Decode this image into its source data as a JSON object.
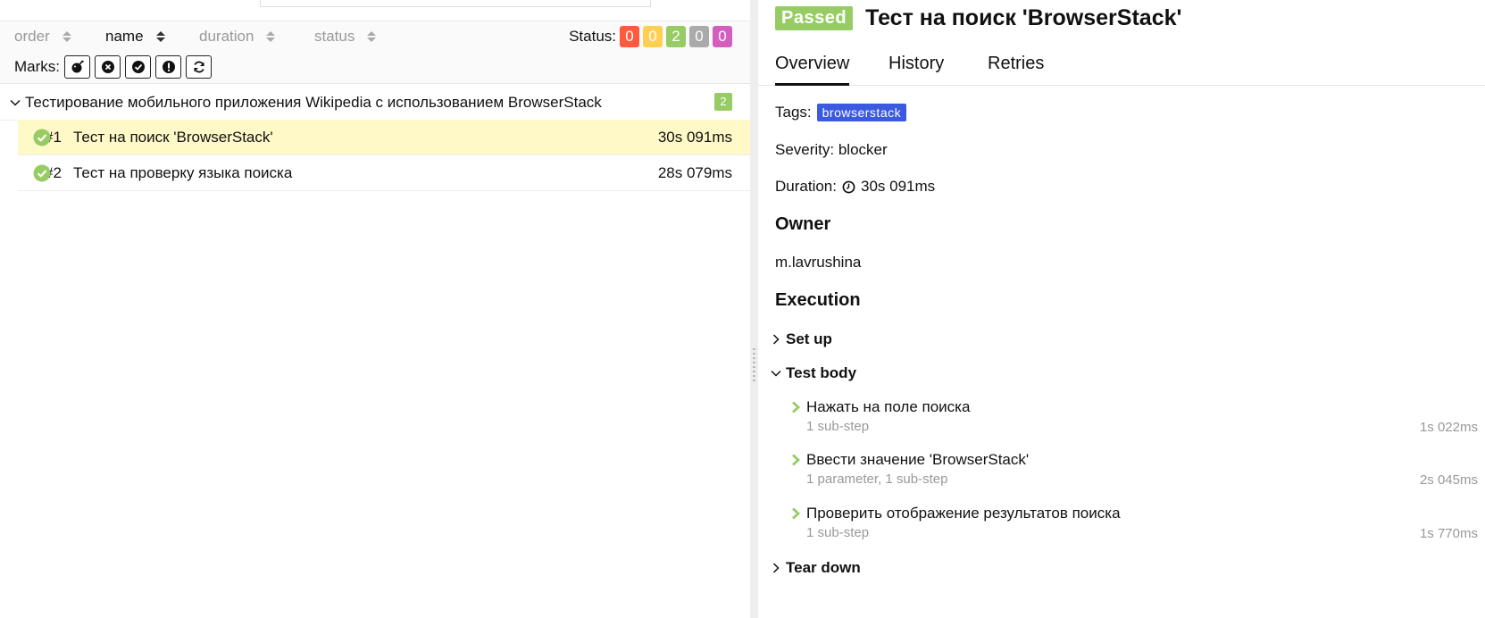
{
  "sortbar": {
    "sorts": [
      "order",
      "name",
      "duration",
      "status"
    ],
    "status_label": "Status:",
    "counts": [
      {
        "value": "0",
        "color": "#fd5a3e"
      },
      {
        "value": "0",
        "color": "#ffd050"
      },
      {
        "value": "2",
        "color": "#97cc64"
      },
      {
        "value": "0",
        "color": "#aaaaaa"
      },
      {
        "value": "0",
        "color": "#d35ebe"
      }
    ],
    "marks_label": "Marks:",
    "mark_icons": [
      "bomb-icon",
      "times-circle-icon",
      "check-circle-icon",
      "exclamation-circle-icon",
      "refresh-icon"
    ]
  },
  "suite": {
    "name": "Тестирование мобильного приложения Wikipedia с использованием BrowserStack",
    "count": "2"
  },
  "tests": [
    {
      "num": "#1",
      "name": "Тест на поиск 'BrowserStack'",
      "duration": "30s 091ms"
    },
    {
      "num": "#2",
      "name": "Тест на проверку языка поиска",
      "duration": "28s 079ms"
    }
  ],
  "detail": {
    "status": "Passed",
    "title": "Тест на поиск 'BrowserStack'",
    "tabs": [
      "Overview",
      "History",
      "Retries"
    ],
    "tags_label": "Tags:",
    "tag": "browserstack",
    "severity": "Severity: blocker",
    "duration_label": "Duration:",
    "duration": "30s 091ms",
    "owner_heading": "Owner",
    "owner": "m.lavrushina",
    "execution_heading": "Execution",
    "setup": "Set up",
    "test_body": "Test body",
    "teardown": "Tear down",
    "steps": [
      {
        "name": "Нажать на поле поиска",
        "sub": "1 sub-step",
        "duration": "1s 022ms"
      },
      {
        "name": "Ввести значение 'BrowserStack'",
        "sub": "1 parameter, 1 sub-step",
        "duration": "2s 045ms"
      },
      {
        "name": "Проверить отображение результатов поиска",
        "sub": "1 sub-step",
        "duration": "1s 770ms"
      }
    ]
  }
}
